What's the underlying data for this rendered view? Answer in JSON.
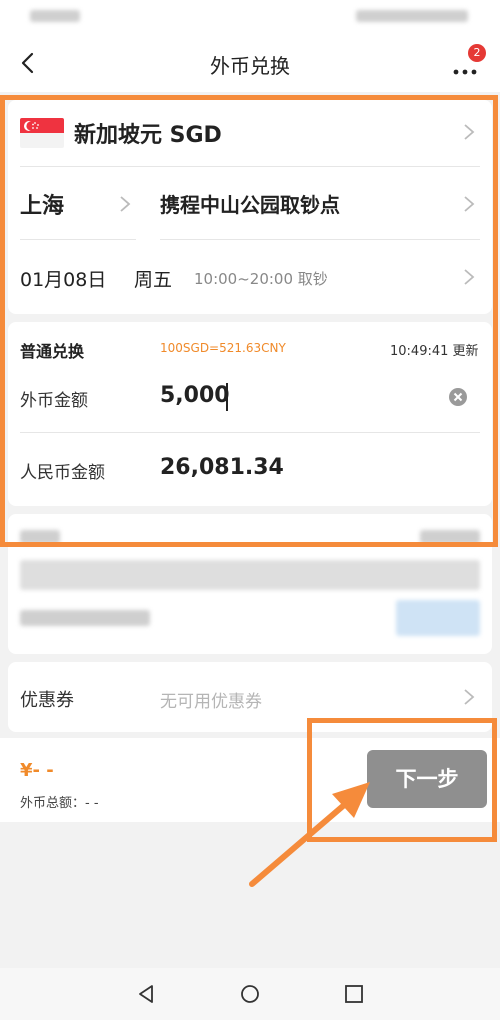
{
  "header": {
    "title": "外币兑换",
    "badge_count": "2"
  },
  "currency": {
    "name": "新加坡元 SGD"
  },
  "location": {
    "city": "上海",
    "pickup_point": "携程中山公园取钞点"
  },
  "pickup_time": {
    "date": "01月08日",
    "weekday": "周五",
    "hours": "10:00~20:00 取钞"
  },
  "exchange": {
    "type_label": "普通兑换",
    "rate": "100SGD=521.63CNY",
    "update_time": "10:49:41 更新",
    "foreign_label": "外币金额",
    "foreign_value": "5,000",
    "cny_label": "人民币金额",
    "cny_value": "26,081.34"
  },
  "coupon": {
    "label": "优惠券",
    "value": "无可用优惠券"
  },
  "footer": {
    "price": "¥- -",
    "total_label": "外币总额：- -",
    "next_label": "下一步"
  },
  "colors": {
    "accent_orange": "#f58b3b",
    "price_orange": "#f08a2a",
    "button_gray": "#8f8f8f"
  }
}
